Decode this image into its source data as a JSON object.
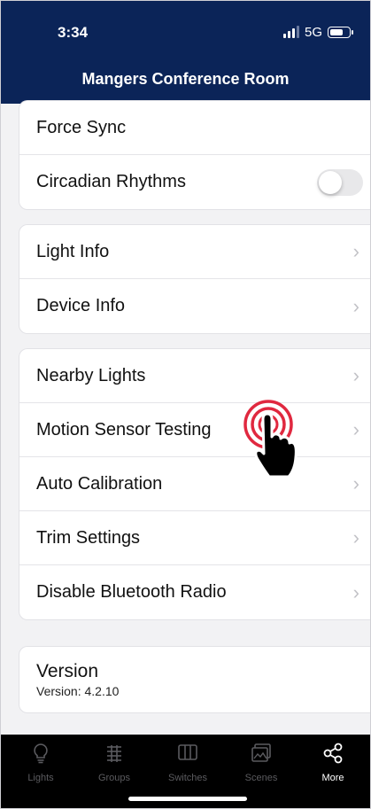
{
  "status": {
    "time": "3:34",
    "network": "5G"
  },
  "header": {
    "title": "Mangers Conference Room"
  },
  "sections": {
    "top": [
      {
        "label": "Force Sync"
      },
      {
        "label": "Circadian Rhythms",
        "toggle": false
      }
    ],
    "info": [
      {
        "label": "Light Info"
      },
      {
        "label": "Device Info"
      }
    ],
    "tools": [
      {
        "label": "Nearby Lights"
      },
      {
        "label": "Motion Sensor Testing"
      },
      {
        "label": "Auto Calibration"
      },
      {
        "label": "Trim Settings"
      },
      {
        "label": "Disable Bluetooth Radio"
      }
    ],
    "version": {
      "title": "Version",
      "value": "Version: 4.2.10"
    }
  },
  "chevron": "›",
  "tabbar": {
    "tabs": [
      {
        "label": "Lights",
        "icon": "lightbulb-icon",
        "active": false
      },
      {
        "label": "Groups",
        "icon": "groups-icon",
        "active": false
      },
      {
        "label": "Switches",
        "icon": "switch-icon",
        "active": false
      },
      {
        "label": "Scenes",
        "icon": "scenes-icon",
        "active": false
      },
      {
        "label": "More",
        "icon": "share-icon",
        "active": true
      }
    ]
  },
  "colors": {
    "header_bg": "#0b2458",
    "tap_indicator": "#e0283f",
    "tabbar_bg": "#000000"
  }
}
